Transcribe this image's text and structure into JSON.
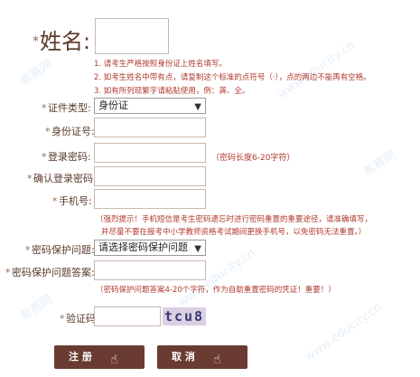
{
  "form": {
    "name": {
      "label": "姓名:",
      "star": "*"
    },
    "name_notes": [
      "1. 请考生严格按照身份证上姓名填写。",
      "2. 如考生姓名中带有点，请复制这个标准的点符号（·），点的两边不能再有空格。",
      "3. 如有所列现繁字请粘贴使用，例：龚、全。"
    ],
    "id_type": {
      "label": "证件类型:",
      "value": "身份证"
    },
    "id_number": {
      "label": "身份证号:"
    },
    "password": {
      "label": "登录密码:",
      "hint": "（密码长度6-20字符）"
    },
    "confirm_password": {
      "label": "确认登录密码:"
    },
    "phone": {
      "label": "手机号:"
    },
    "phone_notes": [
      "（强烈提示！手机短信是考生密码遗忘时进行密码重置的重要途径，请准确填写，",
      "并尽量不要在报考中小学教师资格考试期间更换手机号，以免密码无法重置。）"
    ],
    "security_question": {
      "label": "密码保护问题:",
      "value": "请选择密码保护问题"
    },
    "security_answer": {
      "label": "密码保护问题答案:",
      "hint": "（密码保护问题答案4-20个字符，作为自助重置密码的凭证！重要！）"
    },
    "captcha": {
      "label": "验证码",
      "code": "tcu8"
    },
    "buttons": {
      "register": "注 册",
      "cancel": "取 消"
    }
  },
  "watermarks": [
    "希赛网",
    "www.educity.cn",
    "希赛网",
    "www.educity.cn",
    "希赛网",
    "www.educity.cn"
  ],
  "colors": {
    "label": "#5a3a2a",
    "note": "#b03a2e",
    "button": "#6a3b30"
  }
}
